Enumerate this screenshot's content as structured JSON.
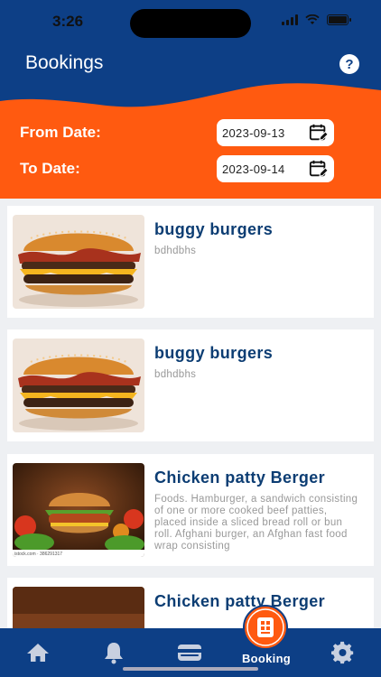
{
  "status_bar": {
    "time": "3:26"
  },
  "header": {
    "title": "Bookings"
  },
  "filters": {
    "from_label": "From Date:",
    "from_value": "2023-09-13",
    "to_label": "To Date:",
    "to_value": "2023-09-14"
  },
  "bookings": [
    {
      "title": "buggy burgers",
      "description": "bdhdbhs",
      "image": "bacon-burger-photo"
    },
    {
      "title": "buggy burgers",
      "description": "bdhdbhs",
      "image": "bacon-burger-photo"
    },
    {
      "title": "Chicken patty Berger",
      "description": "Foods. Hamburger, a sandwich consisting of one or more cooked beef patties, placed inside a sliced bread roll or bun roll. Afghani burger, an Afghan fast food wrap consisting",
      "image": "chicken-burger-photo",
      "image_caption": "istock.com · 386291317"
    },
    {
      "title": "Chicken patty Berger",
      "description": "",
      "image": "chicken-burger-photo"
    }
  ],
  "nav": {
    "items": [
      {
        "icon": "home-icon"
      },
      {
        "icon": "bell-icon"
      },
      {
        "icon": "wallet-icon"
      },
      {
        "icon": "booking-icon",
        "label": "Booking",
        "active": true
      },
      {
        "icon": "gear-icon"
      }
    ]
  },
  "colors": {
    "primary": "#0d3f86",
    "accent": "#ff5a10",
    "title": "#0c3d73"
  }
}
